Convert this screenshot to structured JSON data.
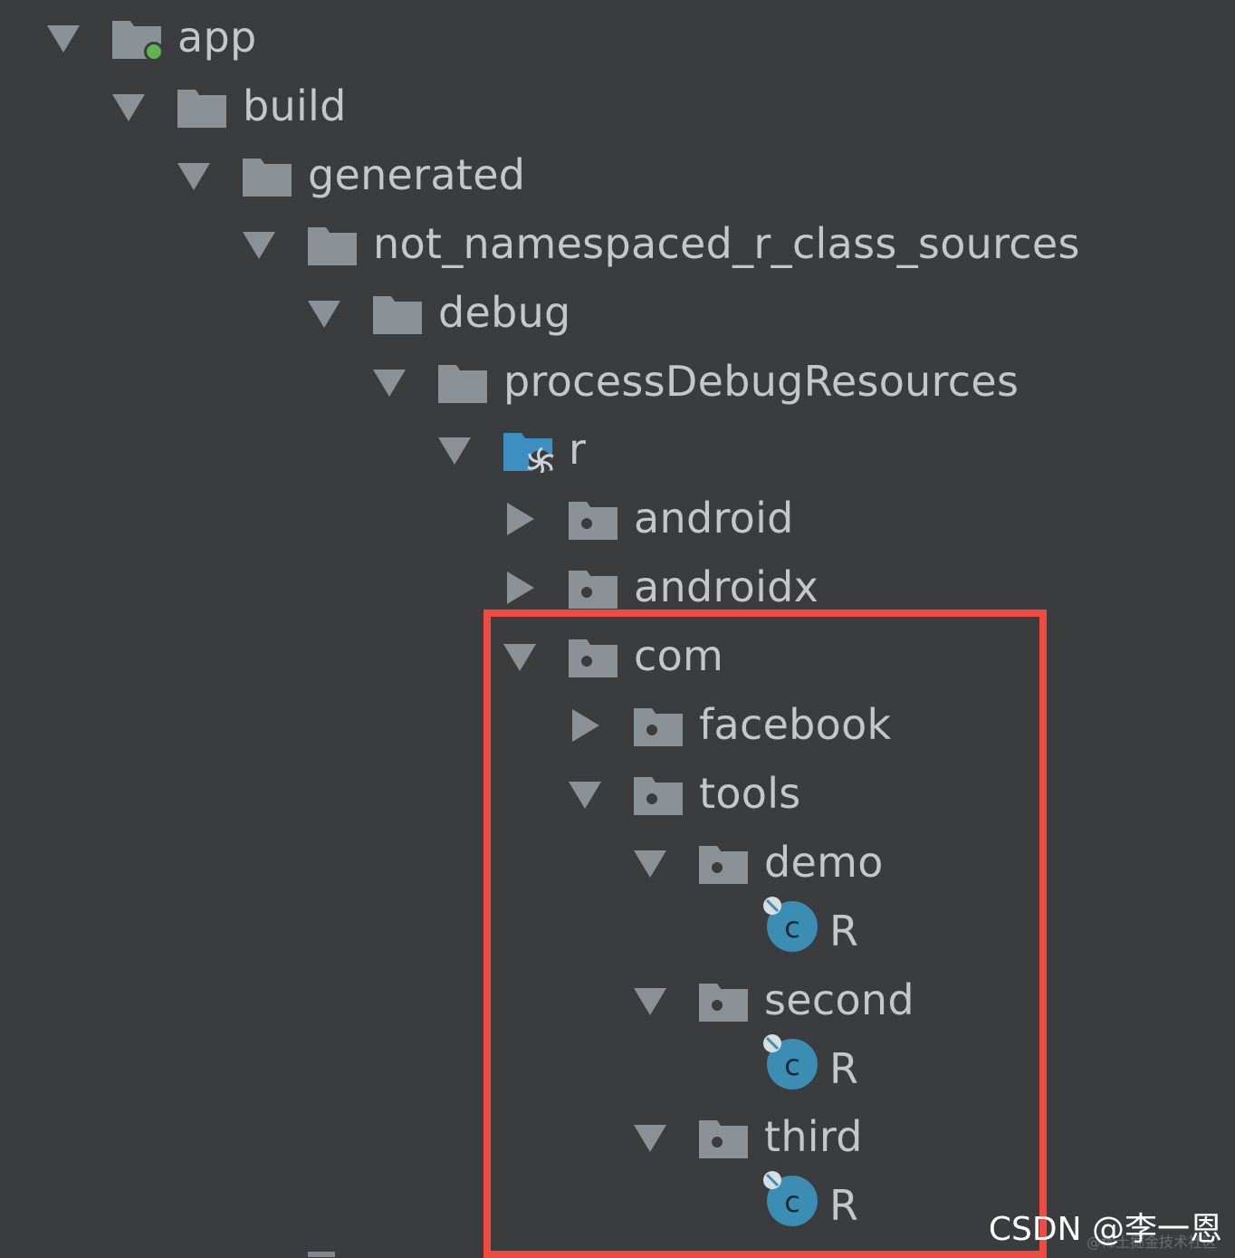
{
  "colors": {
    "background": "#3b3c3e",
    "folder": "#8a9197",
    "package_dot": "#3b3c3e",
    "module_badge": "#5fb451",
    "source_root": "#3d8ec1",
    "class_badge": "#3b8db4",
    "highlight": "#f14a41",
    "text": "#c4c7c9"
  },
  "tree": [
    {
      "label": "app",
      "icon": "module-folder-icon",
      "expanded": true
    },
    {
      "label": "build",
      "icon": "folder-icon",
      "expanded": true
    },
    {
      "label": "generated",
      "icon": "folder-icon",
      "expanded": true
    },
    {
      "label": "not_namespaced_r_class_sources",
      "icon": "folder-icon",
      "expanded": true
    },
    {
      "label": "debug",
      "icon": "folder-icon",
      "expanded": true
    },
    {
      "label": "processDebugResources",
      "icon": "folder-icon",
      "expanded": true
    },
    {
      "label": "r",
      "icon": "generated-source-root-icon",
      "expanded": true
    },
    {
      "label": "android",
      "icon": "package-icon",
      "expanded": false
    },
    {
      "label": "androidx",
      "icon": "package-icon",
      "expanded": false
    },
    {
      "label": "com",
      "icon": "package-icon",
      "expanded": true
    },
    {
      "label": "facebook",
      "icon": "package-icon",
      "expanded": false
    },
    {
      "label": "tools",
      "icon": "package-icon",
      "expanded": true
    },
    {
      "label": "demo",
      "icon": "package-icon",
      "expanded": true
    },
    {
      "label": "R",
      "icon": "class-icon"
    },
    {
      "label": "second",
      "icon": "package-icon",
      "expanded": true
    },
    {
      "label": "R",
      "icon": "class-icon"
    },
    {
      "label": "third",
      "icon": "package-icon",
      "expanded": true
    },
    {
      "label": "R",
      "icon": "class-icon"
    }
  ],
  "watermark": {
    "text": "CSDN @李一恩",
    "faint_text": "@稀土掘金技术社区"
  }
}
